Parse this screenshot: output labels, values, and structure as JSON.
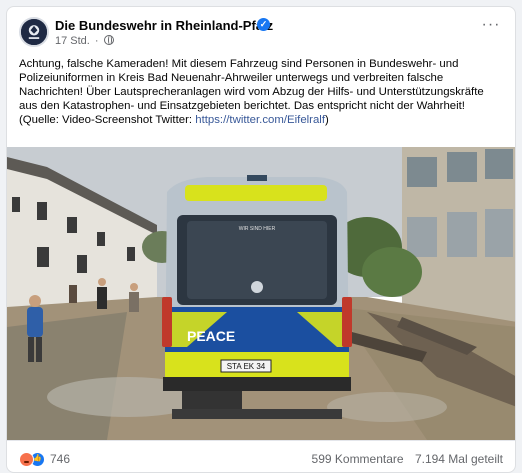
{
  "post": {
    "page_name": "Die Bundeswehr in Rheinland-Pfalz",
    "time": "17 Std.",
    "separator": "·",
    "text": "Achtung, falsche Kameraden! Mit diesem Fahrzeug sind Personen in Bundeswehr- und Polizeiuniformen in Kreis Bad Neuenahr-Ahrweiler unterwegs und verbreiten falsche Nachrichten! Über Lautsprecheranlagen wird vom Abzug der Hilfs- und Unterstützungskräfte aus den Katastrophen- und Einsatzgebieten berichtet. Das entspricht nicht der Wahrheit! (Quelle: Video-Screenshot Twitter: ",
    "link": "https://twitter.com/Eifelralf",
    "text_end": ")",
    "more_icon": "more-horizontal-icon",
    "verified_icon": "verified-badge-icon"
  },
  "photo": {
    "van_label": "PEACE",
    "plate": "STA EK 34",
    "windshield_text": "WIR SIND HIER"
  },
  "footer": {
    "reaction_count": "746",
    "comments": "599 Kommentare",
    "shares": "7.194 Mal geteilt"
  },
  "colors": {
    "link": "#385898",
    "meta": "#65676b",
    "van_blue": "#1b4fa0",
    "van_yellow": "#d8e21c"
  }
}
